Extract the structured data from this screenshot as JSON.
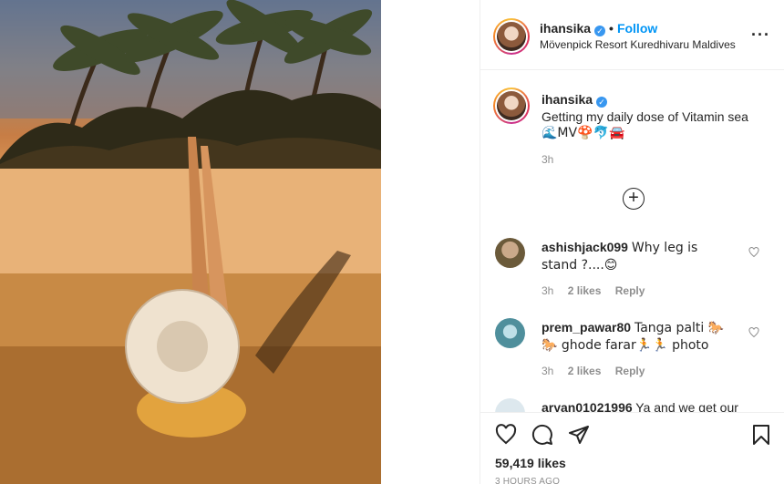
{
  "post": {
    "username": "ihansika",
    "follow_label": "Follow",
    "dot": "•",
    "location": "Mövenpick Resort Kuredhivaru Maldives",
    "more_label": "···"
  },
  "caption": {
    "username": "ihansika",
    "text": "Getting my daily dose of Vitamin sea",
    "emojis": "🌊MV🍄🐬🚘",
    "time": "3h"
  },
  "load_more_label": "+",
  "comments": [
    {
      "username": "ashishjack099",
      "text": "Why leg is stand ?....😊",
      "time": "3h",
      "likes": "2 likes",
      "reply": "Reply"
    },
    {
      "username": "prem_pawar80",
      "text": "Tanga palti 🐎🐎 ghode farar🏃🏃 photo",
      "time": "3h",
      "likes": "2 likes",
      "reply": "Reply"
    },
    {
      "username": "aryan01021996",
      "text": "Ya and we get our"
    }
  ],
  "footer": {
    "likes": "59,419 likes",
    "time_ago": "3 HOURS AGO"
  },
  "colors": {
    "accent": "#0095f6",
    "verified": "#3897f0",
    "muted": "#8e8e8e"
  },
  "icons": [
    "heart-icon",
    "comment-icon",
    "share-icon",
    "bookmark-icon",
    "verified-icon",
    "more-icon",
    "plus-circle-icon"
  ]
}
